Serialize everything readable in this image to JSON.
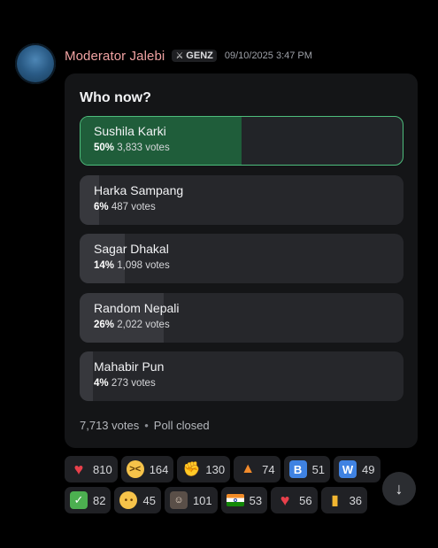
{
  "message": {
    "username": "Moderator Jalebi",
    "tag": "GENZ",
    "tag_icon": "sword-icon",
    "timestamp": "09/10/2025 3:47 PM",
    "name_color": "#f0a2a2"
  },
  "poll": {
    "question": "Who now?",
    "answers": [
      {
        "name": "Sushila Karki",
        "percent": "50%",
        "votes": "3,833 votes",
        "share": 0.5,
        "selected": true
      },
      {
        "name": "Harka Sampang",
        "percent": "6%",
        "votes": "487 votes",
        "share": 0.06,
        "selected": false
      },
      {
        "name": "Sagar Dhakal",
        "percent": "14%",
        "votes": "1,098 votes",
        "share": 0.14,
        "selected": false
      },
      {
        "name": "Random Nepali",
        "percent": "26%",
        "votes": "2,022 votes",
        "share": 0.26,
        "selected": false
      },
      {
        "name": "Mahabir Pun",
        "percent": "4%",
        "votes": "273 votes",
        "share": 0.04,
        "selected": false
      }
    ],
    "total_votes": "7,713 votes",
    "separator": "•",
    "status": "Poll closed",
    "accent_color": "#4dbd7c"
  },
  "reactions": {
    "row1": [
      {
        "icon": "red-heart-icon",
        "count": "810"
      },
      {
        "icon": "weary-face-icon",
        "count": "164"
      },
      {
        "icon": "fist-icon",
        "count": "130"
      },
      {
        "icon": "fire-icon",
        "count": "74"
      },
      {
        "icon": "letter-b-icon",
        "count": "51"
      },
      {
        "icon": "letter-w-icon",
        "count": "49"
      }
    ],
    "row2": [
      {
        "icon": "check-mark-icon",
        "count": "82"
      },
      {
        "icon": "pleading-face-icon",
        "count": "45"
      },
      {
        "icon": "custom-face-emoji-icon",
        "count": "101"
      },
      {
        "icon": "india-flag-icon",
        "count": "53"
      },
      {
        "icon": "red-heart-icon",
        "count": "56"
      },
      {
        "icon": "beer-mug-icon",
        "count": "36"
      }
    ]
  },
  "scroll_button": {
    "icon": "arrow-down-icon"
  }
}
